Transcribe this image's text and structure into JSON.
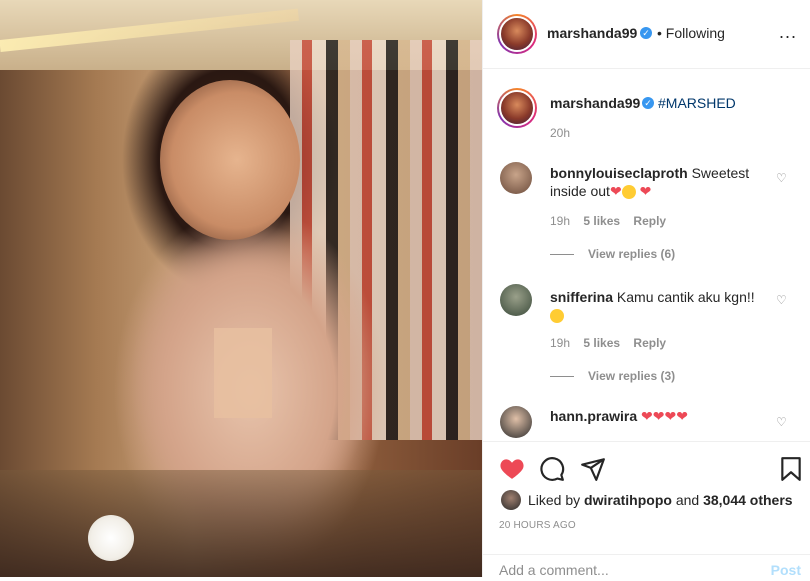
{
  "post": {
    "username": "marshanda99",
    "follow_label": "Following",
    "more_label": "...",
    "caption": {
      "username": "marshanda99",
      "hashtag": "#MARSHED",
      "time": "20h"
    }
  },
  "comments": [
    {
      "username": "bonnylouiseclaproth",
      "text": "Sweetest inside out",
      "time": "19h",
      "likes": "5 likes",
      "reply": "Reply",
      "view_replies": "View replies (6)"
    },
    {
      "username": "snifferina",
      "text": "Kamu cantik aku kgn!!",
      "time": "19h",
      "likes": "5 likes",
      "reply": "Reply",
      "view_replies": "View replies (3)"
    },
    {
      "username": "hann.prawira",
      "text": ""
    }
  ],
  "actions": {
    "liked_prefix": "Liked by",
    "liked_user": "dwiratihpopo",
    "liked_and": "and",
    "liked_others": "38,044 others",
    "time_ago": "20 HOURS AGO"
  },
  "comment_box": {
    "placeholder": "Add a comment...",
    "post_label": "Post"
  },
  "icons": {
    "verified": "verified-badge-icon",
    "like": "heart-filled-icon",
    "comment": "comment-bubble-icon",
    "share": "paper-plane-icon",
    "save": "bookmark-icon",
    "comment_like": "heart-outline-icon",
    "more": "more-options-icon"
  },
  "colors": {
    "like_red": "#ed4956",
    "verified_blue": "#3897f0",
    "hashtag_link": "#00376b",
    "post_disabled": "#b2dffc"
  }
}
